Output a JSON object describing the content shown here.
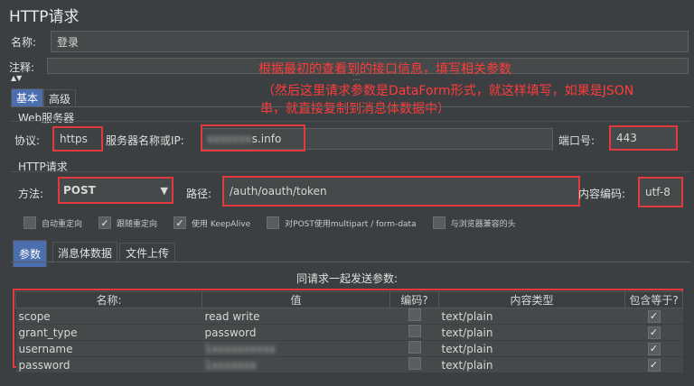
{
  "window": {
    "title": "HTTP请求"
  },
  "name_row": {
    "label": "名称:",
    "value": "登录"
  },
  "comment_row": {
    "label": "注释:",
    "value": ""
  },
  "annotation": {
    "line1": "根据最初的查看到的接口信息，填写相关参数",
    "line2": "（然后这里请求参数是DataForm形式，就这样填写，如果是JSON",
    "line3": "串，就直接复制到消息体数据中）"
  },
  "main_tabs": [
    {
      "label": "基本",
      "active": true
    },
    {
      "label": "高级",
      "active": false
    }
  ],
  "web_server": {
    "section_label": "Web服务器",
    "protocol_label": "协议:",
    "protocol_value": "https",
    "server_label": "服务器名称或IP:",
    "server_value_hidden": "xxxxxxx",
    "server_value_suffix": "s.info",
    "port_label": "端口号:",
    "port_value": "443"
  },
  "http_request": {
    "section_label": "HTTP请求",
    "method_label": "方法:",
    "method_value": "POST",
    "path_label": "路径:",
    "path_value": "/auth/oauth/token",
    "encoding_label": "内容编码:",
    "encoding_value": "utf-8"
  },
  "options": [
    {
      "label": "自动重定向",
      "checked": false
    },
    {
      "label": "跟随重定向",
      "checked": true
    },
    {
      "label": "使用 KeepAlive",
      "checked": true
    },
    {
      "label": "对POST使用multipart / form-data",
      "checked": false
    },
    {
      "label": "与浏览器兼容的头",
      "checked": false
    }
  ],
  "sub_tabs": [
    {
      "label": "参数",
      "active": true
    },
    {
      "label": "消息体数据",
      "active": false
    },
    {
      "label": "文件上传",
      "active": false
    }
  ],
  "params": {
    "caption": "同请求一起发送参数:",
    "columns": [
      "名称:",
      "值",
      "编码?",
      "内容类型",
      "包含等于?"
    ],
    "rows": [
      {
        "name": "scope",
        "value": "read write",
        "value_hidden": false,
        "encode": false,
        "content_type": "text/plain",
        "include_equals": true
      },
      {
        "name": "grant_type",
        "value": "password",
        "value_hidden": false,
        "encode": false,
        "content_type": "text/plain",
        "include_equals": true
      },
      {
        "name": "username",
        "value": "1xxxxxxxxxx",
        "value_hidden": true,
        "encode": false,
        "content_type": "text/plain",
        "include_equals": true
      },
      {
        "name": "password",
        "value": "1xxxxxxx",
        "value_hidden": true,
        "encode": false,
        "content_type": "text/plain",
        "include_equals": true
      }
    ]
  },
  "colors": {
    "background": "#3c3f41",
    "field": "#45494a",
    "highlight": "#e0393e",
    "annotation": "#ff3b3b",
    "active_tab": "#4b6eaf"
  }
}
